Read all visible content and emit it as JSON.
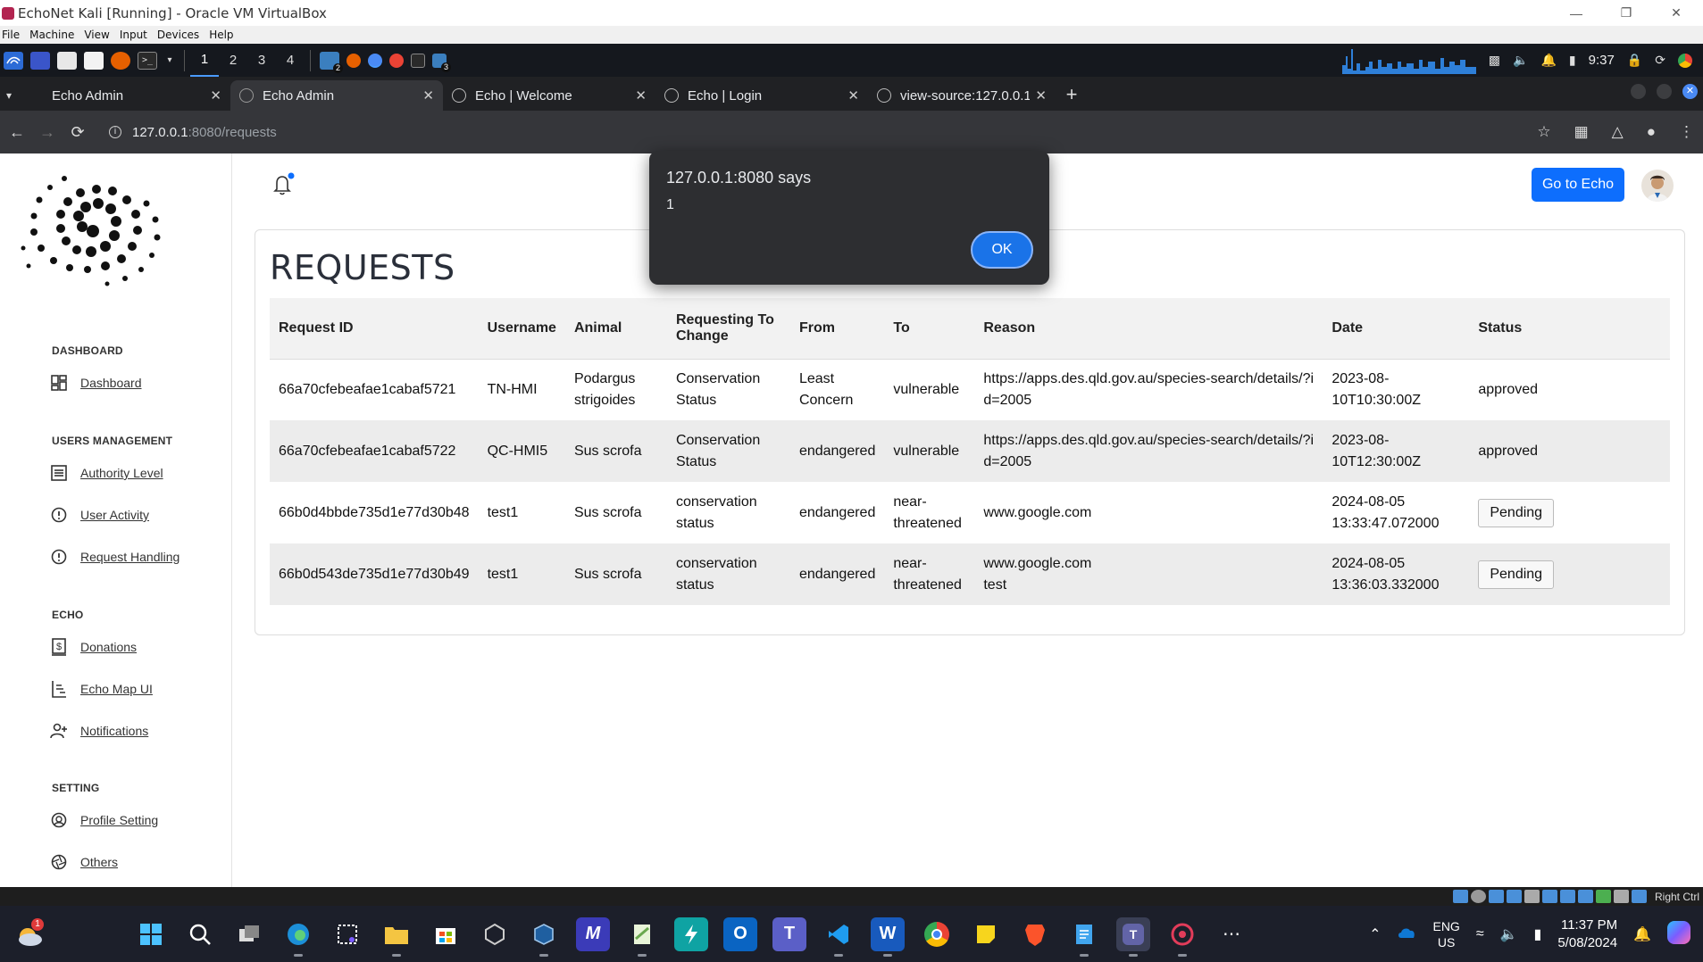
{
  "vbox": {
    "window_title": "EchoNet Kali [Running] - Oracle VM VirtualBox",
    "menu": [
      "File",
      "Machine",
      "View",
      "Input",
      "Devices",
      "Help"
    ],
    "status_right": "Right Ctrl"
  },
  "kali_panel": {
    "workspaces": [
      "1",
      "2",
      "3",
      "4"
    ],
    "active_workspace": "1",
    "badge_a": "2",
    "badge_b": "3",
    "clock": "9:37"
  },
  "browser": {
    "tabs": [
      {
        "title": "Echo Admin",
        "active": false
      },
      {
        "title": "Echo Admin",
        "active": true
      },
      {
        "title": "Echo | Welcome",
        "active": false
      },
      {
        "title": "Echo | Login",
        "active": false
      },
      {
        "title": "view-source:127.0.0.1:8080",
        "active": false
      }
    ],
    "url_host": "127.0.0.1",
    "url_path": ":8080/requests"
  },
  "sidebar": {
    "sections": [
      {
        "title": "DASHBOARD",
        "items": [
          {
            "label": "Dashboard",
            "icon": "dashboard-icon"
          }
        ]
      },
      {
        "title": "USERS MANAGEMENT",
        "items": [
          {
            "label": "Authority Level",
            "icon": "list-icon"
          },
          {
            "label": "User Activity",
            "icon": "alert-circle-icon"
          },
          {
            "label": "Request Handling",
            "icon": "alert-circle-icon"
          }
        ]
      },
      {
        "title": "ECHO",
        "items": [
          {
            "label": "Donations",
            "icon": "dollar-icon"
          },
          {
            "label": "Echo Map UI",
            "icon": "map-icon"
          },
          {
            "label": "Notifications",
            "icon": "user-plus-icon"
          }
        ]
      },
      {
        "title": "SETTING",
        "items": [
          {
            "label": "Profile Setting",
            "icon": "profile-icon"
          },
          {
            "label": "Others",
            "icon": "aperture-icon"
          }
        ]
      }
    ]
  },
  "header": {
    "go_to_echo": "Go to Echo"
  },
  "requests": {
    "title": "REQUESTS",
    "columns": [
      "Request ID",
      "Username",
      "Animal",
      "Requesting To Change",
      "From",
      "To",
      "Reason",
      "Date",
      "Status"
    ],
    "rows": [
      {
        "id": "66a70cfebeafae1cabaf5721",
        "username": "TN-HMI",
        "animal": "Podargus strigoides",
        "change": "Conservation Status",
        "from": "Least Concern",
        "to": "vulnerable",
        "reason": "https://apps.des.qld.gov.au/species-search/details/?id=2005",
        "date": "2023-08-10T10:30:00Z",
        "status": "approved"
      },
      {
        "id": "66a70cfebeafae1cabaf5722",
        "username": "QC-HMI5",
        "animal": "Sus scrofa",
        "change": "Conservation Status",
        "from": "endangered",
        "to": "vulnerable",
        "reason": "https://apps.des.qld.gov.au/species-search/details/?id=2005",
        "date": "2023-08-10T12:30:00Z",
        "status": "approved"
      },
      {
        "id": "66b0d4bbde735d1e77d30b48",
        "username": "test1",
        "animal": "Sus scrofa",
        "change": "conservation status",
        "from": "endangered",
        "to": "near-threatened",
        "reason": "www.google.com",
        "date": "2024-08-05 13:33:47.072000",
        "status": "Pending"
      },
      {
        "id": "66b0d543de735d1e77d30b49",
        "username": "test1",
        "animal": "Sus scrofa",
        "change": "conservation status",
        "from": "endangered",
        "to": "near-threatened",
        "reason": "www.google.com test",
        "date": "2024-08-05 13:36:03.332000",
        "status": "Pending"
      }
    ]
  },
  "alert": {
    "title": "127.0.0.1:8080 says",
    "message": "1",
    "ok": "OK"
  },
  "taskbar": {
    "weather_badge": "1",
    "lang_top": "ENG",
    "lang_bottom": "US",
    "time": "11:37 PM",
    "date": "5/08/2024"
  },
  "colors": {
    "accent": "#0d6efd",
    "dialog_bg": "#2d2e31",
    "ok_button": "#1a73e8"
  }
}
